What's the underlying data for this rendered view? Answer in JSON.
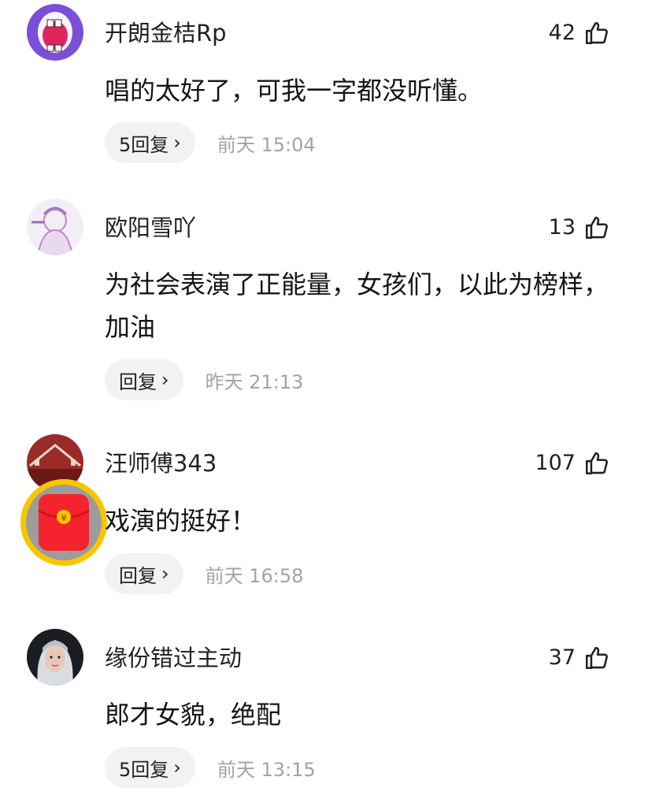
{
  "comments": [
    {
      "username": "开朗金桔Rp",
      "likes": "42",
      "text": "唱的太好了，可我一字都没听懂。",
      "reply_label": "5回复",
      "time": "前天 15:04"
    },
    {
      "username": "欧阳雪吖",
      "likes": "13",
      "text": "为社会表演了正能量，女孩们，以此为榜样，加油",
      "reply_label": "回复",
      "time": "昨天 21:13"
    },
    {
      "username": "汪师傅343",
      "likes": "107",
      "text": "戏演的挺好！",
      "reply_label": "回复",
      "time": "前天 16:58"
    },
    {
      "username": "缘份错过主动",
      "likes": "37",
      "text": "郎才女貌，绝配",
      "reply_label": "5回复",
      "time": "前天 13:15"
    }
  ],
  "icons": {
    "like": "thumbs-up-outline-icon",
    "chevron": "chevron-right-icon",
    "red_packet": "red-envelope-icon"
  },
  "colors": {
    "red_packet": "#f5232e",
    "red_packet_ring": "#f7c600",
    "reply_bg": "#f2f2f2",
    "time_text": "#a3a3a3"
  }
}
